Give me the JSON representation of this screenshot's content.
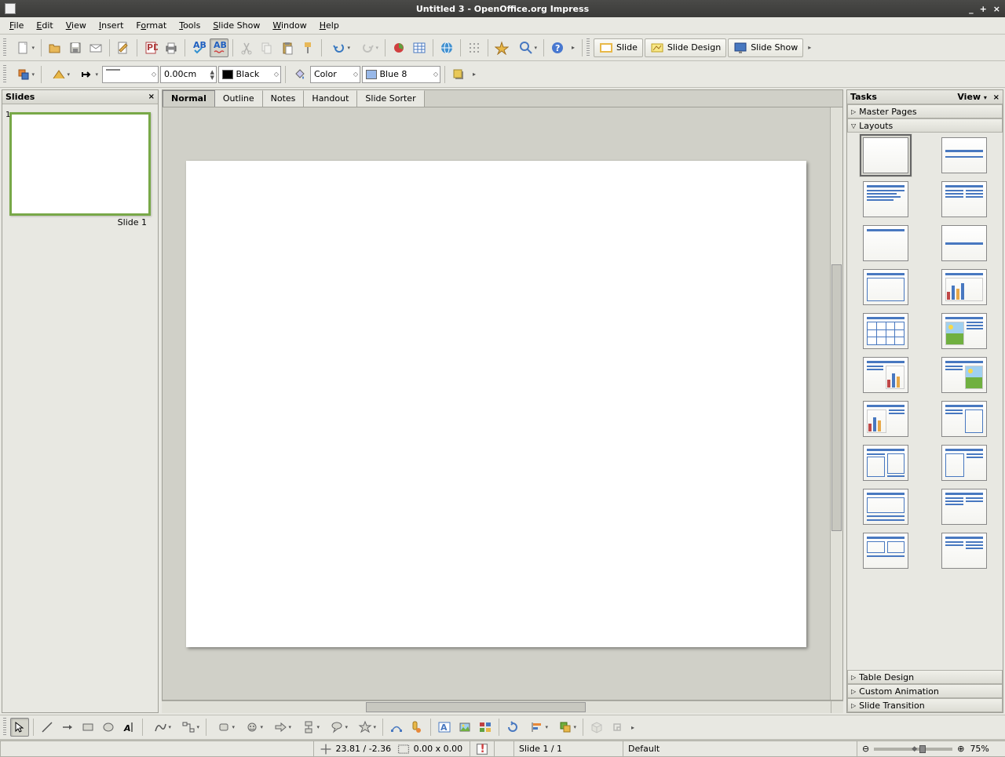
{
  "title": "Untitled 3 - OpenOffice.org Impress",
  "menu": [
    "File",
    "Edit",
    "View",
    "Insert",
    "Format",
    "Tools",
    "Slide Show",
    "Window",
    "Help"
  ],
  "toolbar1": {
    "slide": "Slide",
    "slide_design": "Slide Design",
    "slide_show": "Slide Show"
  },
  "toolbar2": {
    "line_width": "0.00cm",
    "line_color_label": "Black",
    "fill_mode": "Color",
    "fill_color": "Blue 8"
  },
  "slides_panel": {
    "title": "Slides",
    "items": [
      {
        "num": "1",
        "label": "Slide 1"
      }
    ]
  },
  "view_tabs": [
    "Normal",
    "Outline",
    "Notes",
    "Handout",
    "Slide Sorter"
  ],
  "tasks_panel": {
    "title": "Tasks",
    "view_label": "View",
    "sections": {
      "master_pages": "Master Pages",
      "layouts": "Layouts",
      "table_design": "Table Design",
      "custom_animation": "Custom Animation",
      "slide_transition": "Slide Transition"
    }
  },
  "statusbar": {
    "coords": "23.81 / -2.36",
    "size": "0.00 x 0.00",
    "slide": "Slide 1 / 1",
    "template": "Default",
    "zoom": "75%"
  }
}
